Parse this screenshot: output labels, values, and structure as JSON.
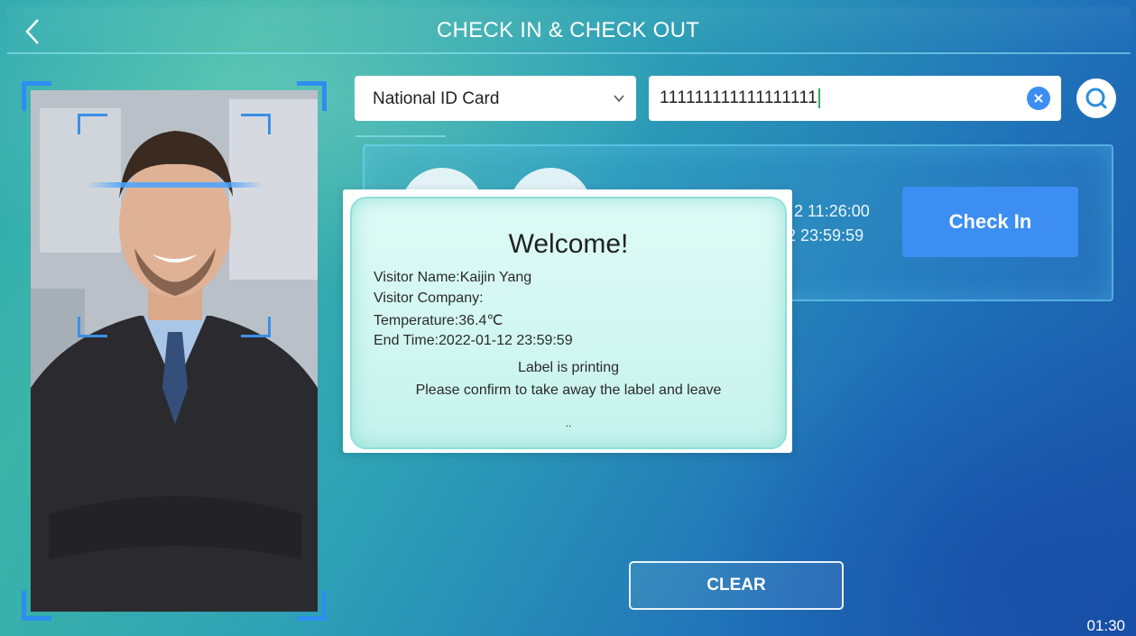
{
  "header": {
    "title": "CHECK IN & CHECK OUT"
  },
  "search": {
    "id_type_selected": "National ID Card",
    "id_value": "111111111111111111"
  },
  "record": {
    "start_time_fragment": "2 11:26:00",
    "end_time_fragment": "2 23:59:59",
    "check_in_label": "Check In"
  },
  "dialog": {
    "title": "Welcome!",
    "visitor_name": "Visitor Name:Kaijin Yang",
    "visitor_company": "Visitor Company:",
    "temperature": "Temperature:36.4℃",
    "end_time": "End Time:2022-01-12 23:59:59",
    "status": "Label is printing",
    "instruction": "Please confirm to take away the label and leave",
    "loading": ".."
  },
  "footer": {
    "clear_label": "CLEAR",
    "countdown": "01:30"
  },
  "colors": {
    "accent_blue": "#3d8ef2",
    "frame_blue": "#2e8df0",
    "dialog_bg": "#dffbf6"
  }
}
